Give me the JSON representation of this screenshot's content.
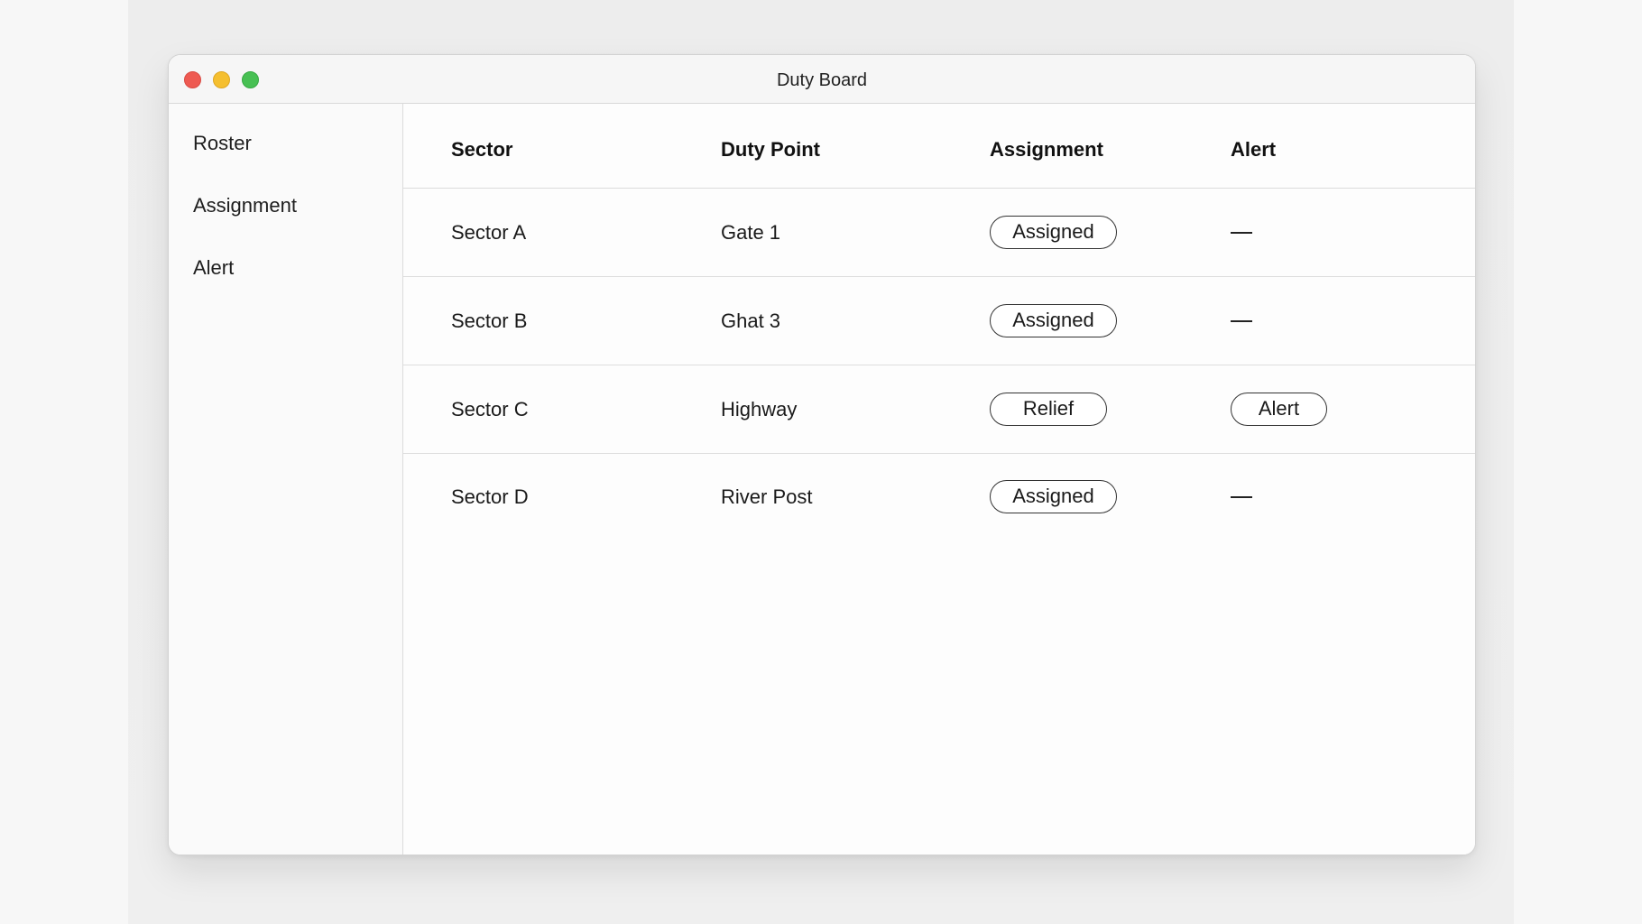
{
  "window": {
    "title": "Duty Board"
  },
  "sidebar": {
    "items": [
      {
        "label": "Roster"
      },
      {
        "label": "Assignment"
      },
      {
        "label": "Alert"
      }
    ]
  },
  "table": {
    "headers": [
      "Sector",
      "Duty Point",
      "Assignment",
      "Alert"
    ],
    "rows": [
      {
        "sector": "Sector A",
        "duty_point": "Gate 1",
        "assignment": "Assigned",
        "alert": "—"
      },
      {
        "sector": "Sector B",
        "duty_point": "Ghat 3",
        "assignment": "Assigned",
        "alert": "—"
      },
      {
        "sector": "Sector C",
        "duty_point": "Highway",
        "assignment": "Relief",
        "alert": "Alert"
      },
      {
        "sector": "Sector D",
        "duty_point": "River Post",
        "assignment": "Assigned",
        "alert": "—"
      }
    ]
  },
  "colors": {
    "close": "#ee5a52",
    "minimize": "#f5bf2f",
    "maximize": "#47c053"
  }
}
